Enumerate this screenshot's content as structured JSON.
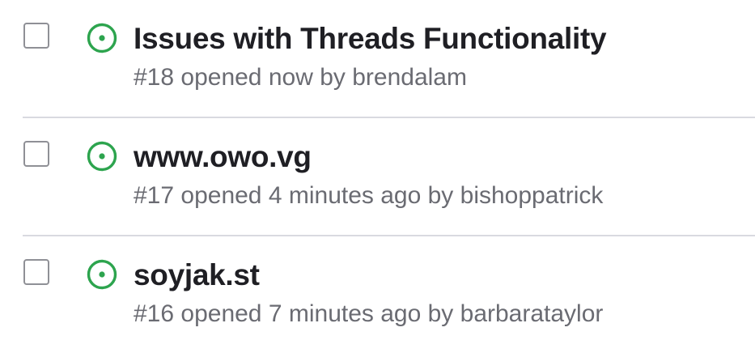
{
  "issues": [
    {
      "title": "Issues with Threads Functionality",
      "meta": "#18 opened now by brendalam",
      "status_icon": "issue-open-icon"
    },
    {
      "title": "www.owo.vg",
      "meta": "#17 opened 4 minutes ago by bishoppatrick",
      "status_icon": "issue-open-icon"
    },
    {
      "title": "soyjak.st",
      "meta": "#16 opened 7 minutes ago by barbarataylor",
      "status_icon": "issue-open-icon"
    }
  ],
  "colors": {
    "open_status": "#2da44e",
    "title": "#1f1f24",
    "meta": "#6a6b72",
    "divider": "#d9dae0"
  }
}
